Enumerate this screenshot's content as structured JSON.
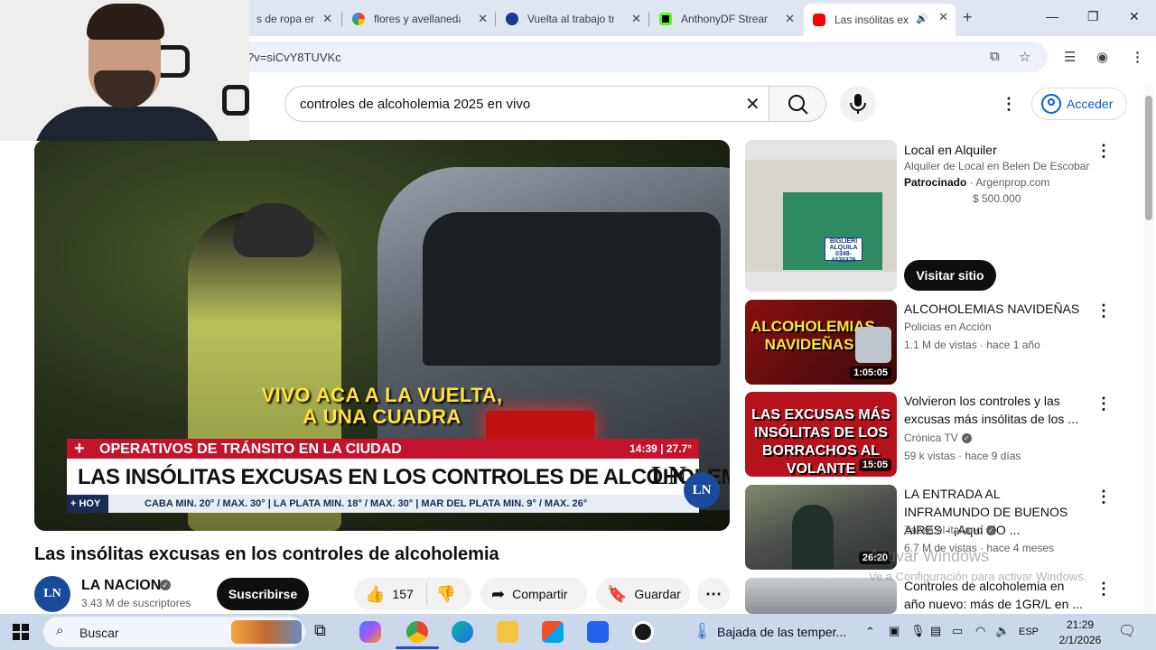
{
  "browser": {
    "tabs": [
      {
        "title": "s de ropa en",
        "active": false
      },
      {
        "title": "flores y avellaneda",
        "active": false
      },
      {
        "title": "Vuelta al trabajo tr",
        "active": false
      },
      {
        "title": "AnthonyDF Stream",
        "active": false
      },
      {
        "title": "Las insólitas ex",
        "active": true
      }
    ],
    "url_fragment": "?v=siCvY8TUVKc"
  },
  "youtube": {
    "search_query": "controles de alcoholemia 2025 en vivo",
    "sign_in_label": "Acceder"
  },
  "player": {
    "subtitle_line1": "VIVO ACA A LA VUELTA,",
    "subtitle_line2": "A UNA CUADRA",
    "lower_third_top": "OPERATIVOS DE TRÁNSITO EN LA CIUDAD",
    "lower_third_time": "14:39 | 27.7°",
    "lower_third_main": "LAS INSÓLITAS EXCUSAS EN LOS CONTROLES DE ALCOHOLEMIA",
    "lower_third_logo": "LN",
    "ticker_label": "+ HOY",
    "ticker_text": "CABA  MIN. 20° / MAX. 30°  |  LA PLATA  MIN. 18° / MAX. 30°  |  MAR DEL PLATA  MIN. 9° / MAX. 26°",
    "watermark_logo": "LN"
  },
  "video": {
    "title": "Las insólitas excusas en los controles de alcoholemia",
    "channel_name": "LA NACION",
    "channel_avatar": "LN",
    "subscribers": "3.43 M de suscriptores",
    "subscribe_label": "Suscribirse",
    "likes": "157",
    "share_label": "Compartir",
    "save_label": "Guardar"
  },
  "sidebar": {
    "ad": {
      "title": "Local en Alquiler",
      "description": "Alquiler de Local en Belen De Escobar",
      "sponsored": "Patrocinado",
      "domain": "Argenprop.com",
      "price": "$ 500.000",
      "cta": "Visitar sitio",
      "sign_text1": "BIGLIERI",
      "sign_text2": "ALQUILA",
      "sign_text3": "0348-4420376"
    },
    "videos": [
      {
        "title": "ALCOHOLEMIAS NAVIDEÑAS",
        "channel": "Policias en Acción",
        "verified": false,
        "views": "1.1 M de vistas",
        "age": "hace 1 año",
        "duration": "1:05:05",
        "thumb_text": "ALCOHOLEMIAS NAVIDEÑAS"
      },
      {
        "title": "Volvieron los controles y las excusas más insólitas de los ...",
        "channel": "Crónica TV",
        "verified": true,
        "views": "59 k vistas",
        "age": "hace 9 días",
        "duration": "15:05",
        "thumb_text": "LAS EXCUSAS MÁS INSÓLITAS DE LOS BORRACHOS AL VOLANTE"
      },
      {
        "title": "LA ENTRADA AL INFRAMUNDO DE BUENOS AIRES - ¡Aquí NO ...",
        "channel": "Zazza el italiano",
        "verified": true,
        "views": "6.7 M de vistas",
        "age": "hace 4 meses",
        "duration": "26:20"
      },
      {
        "title": "Controles de alcoholemia en año nuevo: más de 1GR/L en ...",
        "channel": "",
        "verified": false,
        "views": "",
        "age": "",
        "duration": ""
      }
    ]
  },
  "windows_watermark": {
    "line1": "Activar Windows",
    "line2": "Ve a Configuración para activar Windows."
  },
  "taskbar": {
    "search_placeholder": "Buscar",
    "weather_text": "Bajada de las temper...",
    "language": "ESP",
    "time": "21:29",
    "date": "2/1/2026"
  }
}
